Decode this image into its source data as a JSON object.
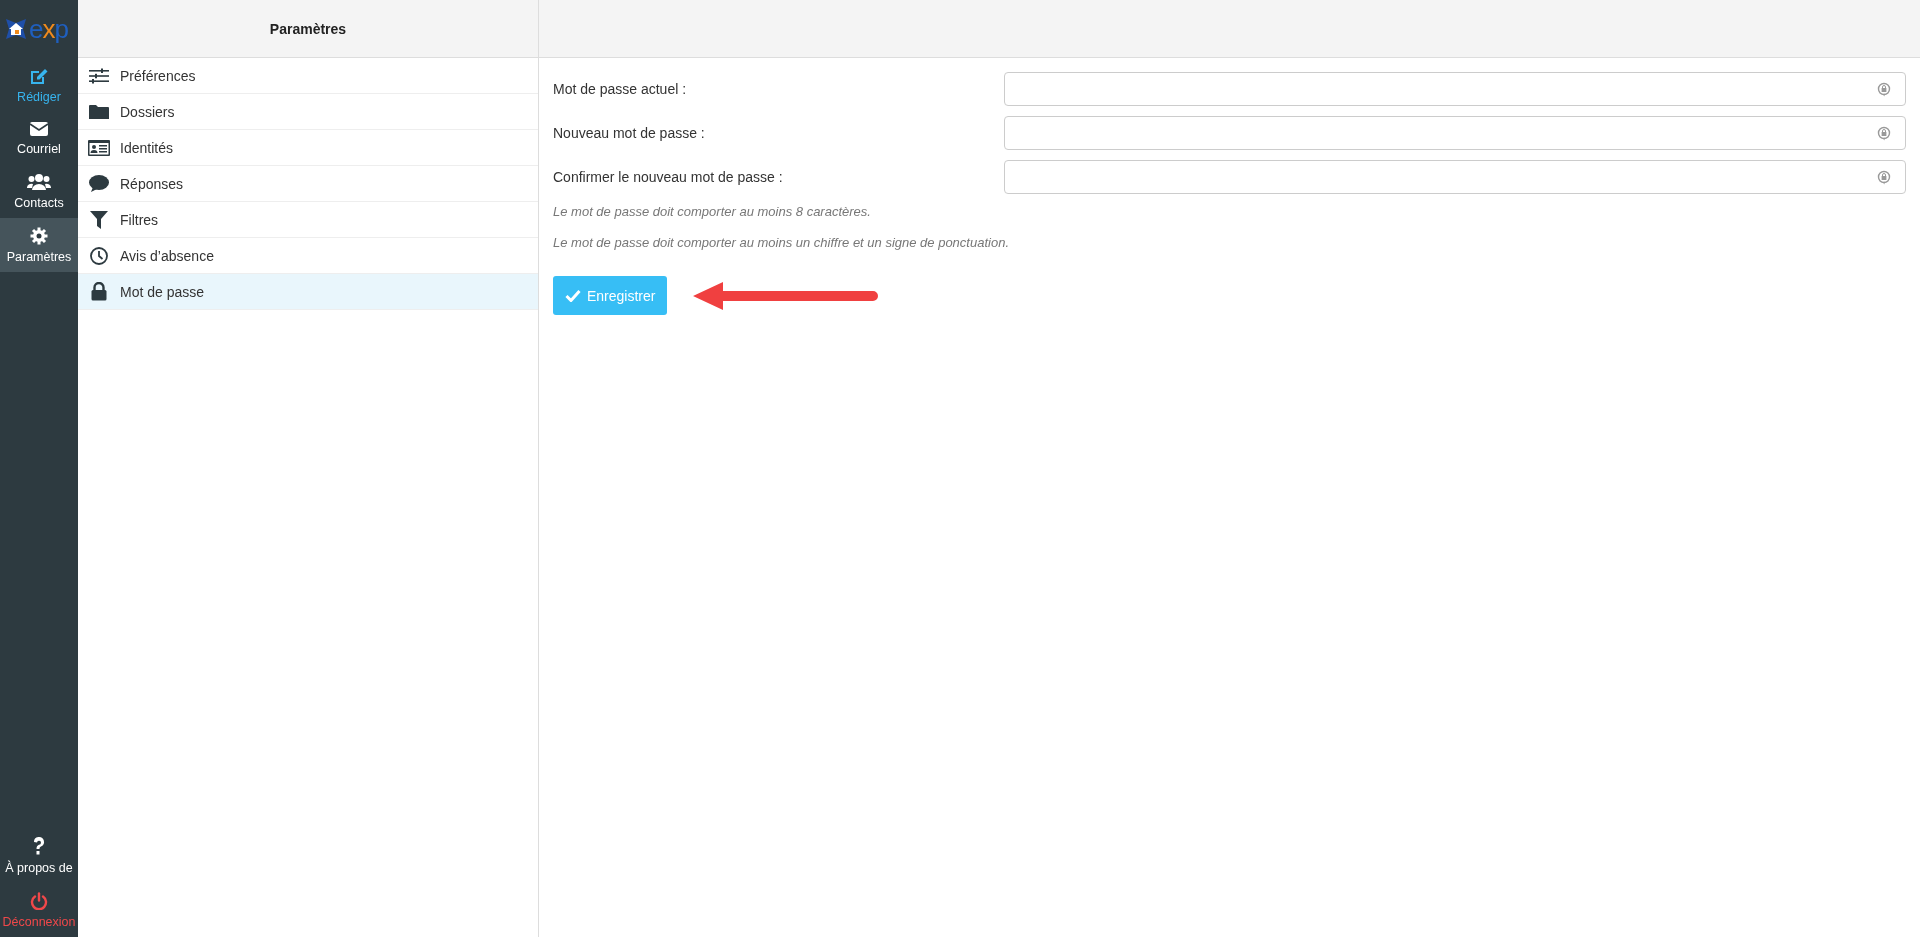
{
  "logo": {
    "text_start": "e",
    "text_mid": "x",
    "text_end": "p"
  },
  "nav": {
    "items": [
      {
        "label": "Rédiger",
        "kind": "compose",
        "selected": false
      },
      {
        "label": "Courriel",
        "kind": "mail",
        "selected": false
      },
      {
        "label": "Contacts",
        "kind": "contacts",
        "selected": false
      },
      {
        "label": "Paramètres",
        "kind": "settings",
        "selected": true
      }
    ],
    "bottom_items": [
      {
        "label": "À propos de",
        "kind": "help"
      },
      {
        "label": "Déconnexion",
        "kind": "logout"
      }
    ]
  },
  "settings": {
    "title": "Paramètres",
    "items": [
      {
        "label": "Préférences",
        "kind": "sliders",
        "selected": false
      },
      {
        "label": "Dossiers",
        "kind": "folder",
        "selected": false
      },
      {
        "label": "Identités",
        "kind": "idcard",
        "selected": false
      },
      {
        "label": "Réponses",
        "kind": "comment",
        "selected": false
      },
      {
        "label": "Filtres",
        "kind": "filter",
        "selected": false
      },
      {
        "label": "Avis d’absence",
        "kind": "clock",
        "selected": false
      },
      {
        "label": "Mot de passe",
        "kind": "lock",
        "selected": true
      }
    ]
  },
  "form": {
    "fields": [
      {
        "label": "Mot de passe actuel :"
      },
      {
        "label": "Nouveau mot de passe :"
      },
      {
        "label": "Confirmer le nouveau mot de passe :"
      }
    ],
    "hints": [
      "Le mot de passe doit comporter au moins 8 caractères.",
      "Le mot de passe doit comporter au moins un chiffre et un signe de ponctuation."
    ],
    "save_button": "Enregistrer"
  }
}
